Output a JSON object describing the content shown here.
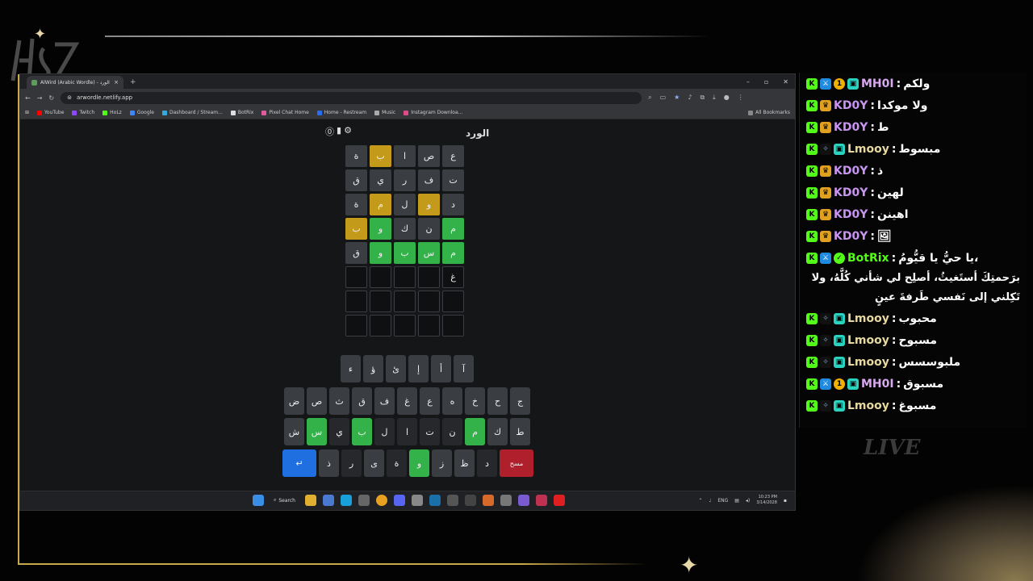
{
  "browser": {
    "tab_title": "AlWird (Arabic Wordle) - الورد",
    "tab_close": "×",
    "new_tab": "+",
    "window_controls": [
      "–",
      "▫",
      "✕"
    ],
    "url": "arwordle.netlify.app",
    "bookmarks": [
      {
        "label": "YouTube",
        "color": "#ff0000"
      },
      {
        "label": "Twitch",
        "color": "#9146ff"
      },
      {
        "label": "HoLz",
        "color": "#53fc18"
      },
      {
        "label": "Google",
        "color": "#4285f4"
      },
      {
        "label": "Dashboard / Stream...",
        "color": "#3ad"
      },
      {
        "label": "BotRix",
        "color": "#ddd"
      },
      {
        "label": "Pixel Chat Home",
        "color": "#e05aa0"
      },
      {
        "label": "Home - Restream",
        "color": "#2a6cf0"
      },
      {
        "label": "Music",
        "color": "#aaa"
      },
      {
        "label": "Instagram Downloa...",
        "color": "#e04a8a"
      }
    ],
    "all_bookmarks": "All Bookmarks"
  },
  "game": {
    "title": "الورد",
    "icons": [
      "help-icon",
      "stats-icon",
      "settings-icon"
    ],
    "grid": [
      [
        {
          "l": "ع",
          "s": "absent"
        },
        {
          "l": "ص",
          "s": "absent"
        },
        {
          "l": "ا",
          "s": "absent"
        },
        {
          "l": "ب",
          "s": "present"
        },
        {
          "l": "ة",
          "s": "absent"
        }
      ],
      [
        {
          "l": "ت",
          "s": "absent"
        },
        {
          "l": "ف",
          "s": "absent"
        },
        {
          "l": "ر",
          "s": "absent"
        },
        {
          "l": "ي",
          "s": "absent"
        },
        {
          "l": "ق",
          "s": "absent"
        }
      ],
      [
        {
          "l": "د",
          "s": "absent"
        },
        {
          "l": "و",
          "s": "present"
        },
        {
          "l": "ل",
          "s": "absent"
        },
        {
          "l": "م",
          "s": "present"
        },
        {
          "l": "ة",
          "s": "absent"
        }
      ],
      [
        {
          "l": "م",
          "s": "correct"
        },
        {
          "l": "ن",
          "s": "absent"
        },
        {
          "l": "ك",
          "s": "absent"
        },
        {
          "l": "و",
          "s": "correct"
        },
        {
          "l": "ب",
          "s": "present"
        }
      ],
      [
        {
          "l": "م",
          "s": "correct"
        },
        {
          "l": "س",
          "s": "correct"
        },
        {
          "l": "ب",
          "s": "correct"
        },
        {
          "l": "و",
          "s": "correct"
        },
        {
          "l": "ق",
          "s": "absent"
        }
      ],
      [
        {
          "l": "غ",
          "s": "typed"
        },
        {
          "l": "",
          "s": "empty"
        },
        {
          "l": "",
          "s": "empty"
        },
        {
          "l": "",
          "s": "empty"
        },
        {
          "l": "",
          "s": "empty"
        }
      ],
      [
        {
          "l": "",
          "s": "empty"
        },
        {
          "l": "",
          "s": "empty"
        },
        {
          "l": "",
          "s": "empty"
        },
        {
          "l": "",
          "s": "empty"
        },
        {
          "l": "",
          "s": "empty"
        }
      ],
      [
        {
          "l": "",
          "s": "empty"
        },
        {
          "l": "",
          "s": "empty"
        },
        {
          "l": "",
          "s": "empty"
        },
        {
          "l": "",
          "s": "empty"
        },
        {
          "l": "",
          "s": "empty"
        }
      ]
    ],
    "keyboard": [
      [
        {
          "k": "آ"
        },
        {
          "k": "أ"
        },
        {
          "k": "إ"
        },
        {
          "k": "ئ"
        },
        {
          "k": "ؤ"
        },
        {
          "k": "ء"
        }
      ],
      [
        {
          "k": "ج"
        },
        {
          "k": "ح"
        },
        {
          "k": "خ"
        },
        {
          "k": "ه"
        },
        {
          "k": "ع"
        },
        {
          "k": "غ"
        },
        {
          "k": "ف"
        },
        {
          "k": "ق"
        },
        {
          "k": "ث"
        },
        {
          "k": "ص"
        },
        {
          "k": "ض"
        }
      ],
      [
        {
          "k": "ط"
        },
        {
          "k": "ك"
        },
        {
          "k": "م",
          "s": "correct"
        },
        {
          "k": "ن",
          "s": "dark"
        },
        {
          "k": "ت",
          "s": "dark"
        },
        {
          "k": "ا",
          "s": "dark"
        },
        {
          "k": "ل",
          "s": "dark"
        },
        {
          "k": "ب",
          "s": "correct"
        },
        {
          "k": "ي",
          "s": "dark"
        },
        {
          "k": "س",
          "s": "correct"
        },
        {
          "k": "ش"
        }
      ],
      [
        {
          "k": "مسح",
          "s": "delete"
        },
        {
          "k": "د",
          "s": "dark"
        },
        {
          "k": "ظ"
        },
        {
          "k": "ز"
        },
        {
          "k": "و",
          "s": "correct"
        },
        {
          "k": "ة",
          "s": "dark"
        },
        {
          "k": "ى"
        },
        {
          "k": "ر",
          "s": "dark"
        },
        {
          "k": "ذ"
        },
        {
          "k": "↵",
          "s": "enter"
        }
      ]
    ]
  },
  "taskbar": {
    "search_label": "Search",
    "lang": "ENG",
    "time": "10:23 PM",
    "date": "3/14/2028"
  },
  "chat": {
    "messages": [
      {
        "badges": [
          "b-k",
          "b-mod",
          "b-one",
          "b-gift"
        ],
        "user": "MH0I",
        "cls": "name-mh",
        "text": "ولكم"
      },
      {
        "badges": [
          "b-k",
          "b-crown"
        ],
        "user": "KD0Y",
        "cls": "name-kd",
        "text": "ولا موكدا"
      },
      {
        "badges": [
          "b-k",
          "b-crown"
        ],
        "user": "KD0Y",
        "cls": "name-kd",
        "text": "ط"
      },
      {
        "badges": [
          "b-k",
          "b-spark",
          "b-gift"
        ],
        "user": "Lmooy",
        "cls": "name-lm",
        "text": "مبسوط"
      },
      {
        "badges": [
          "b-k",
          "b-crown"
        ],
        "user": "KD0Y",
        "cls": "name-kd",
        "text": "ذ"
      },
      {
        "badges": [
          "b-k",
          "b-crown"
        ],
        "user": "KD0Y",
        "cls": "name-kd",
        "text": "لهين"
      },
      {
        "badges": [
          "b-k",
          "b-crown"
        ],
        "user": "KD0Y",
        "cls": "name-kd",
        "text": "اهينن"
      },
      {
        "badges": [
          "b-k",
          "b-crown"
        ],
        "user": "KD0Y",
        "cls": "name-kd",
        "text": "🖼"
      },
      {
        "badges": [
          "b-k",
          "b-mod",
          "b-bot"
        ],
        "user": "BotRix",
        "cls": "name-bot",
        "text": "يا حيُّ يا قيُّومُ،",
        "long": "برَحمتِكَ أستَغيثُ، أصلِح لي شأني كُلَّهُ، ولا تَكِلني إلى نَفسي طَرفةَ عينٍ"
      },
      {
        "badges": [
          "b-k",
          "b-spark",
          "b-gift"
        ],
        "user": "Lmooy",
        "cls": "name-lm",
        "text": "محبوب"
      },
      {
        "badges": [
          "b-k",
          "b-spark",
          "b-gift"
        ],
        "user": "Lmooy",
        "cls": "name-lm",
        "text": "مسبوح"
      },
      {
        "badges": [
          "b-k",
          "b-spark",
          "b-gift"
        ],
        "user": "Lmooy",
        "cls": "name-lm",
        "text": "ملبوسسس"
      },
      {
        "badges": [
          "b-k",
          "b-mod",
          "b-one",
          "b-gift"
        ],
        "user": "MH0I",
        "cls": "name-mh",
        "text": "مسبوق"
      },
      {
        "badges": [
          "b-k",
          "b-spark",
          "b-gift"
        ],
        "user": "Lmooy",
        "cls": "name-lm",
        "text": "مسبوغ"
      }
    ],
    "live_label": "LIVE"
  },
  "colors": {
    "present": "#c49a1b",
    "correct": "#33b24a",
    "absent": "#3a3d42",
    "enter": "#1f6fe0",
    "delete": "#b0202c"
  }
}
